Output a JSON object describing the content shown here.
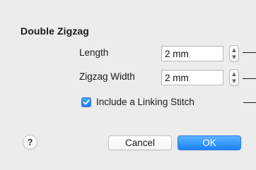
{
  "dialog": {
    "title": "Double Zigzag"
  },
  "fields": {
    "length": {
      "label": "Length",
      "value": "2 mm"
    },
    "zigzag_width": {
      "label": "Zigzag Width",
      "value": "2 mm"
    }
  },
  "linking_stitch": {
    "label": "Include a Linking Stitch",
    "checked": true
  },
  "buttons": {
    "help_label": "?",
    "cancel_label": "Cancel",
    "ok_label": "OK"
  },
  "icons": {
    "stepper_up": "chevron-up-icon",
    "stepper_down": "chevron-down-icon",
    "checkmark": "checkmark-icon"
  },
  "colors": {
    "background": "#ececec",
    "accent": "#1a82fb"
  }
}
